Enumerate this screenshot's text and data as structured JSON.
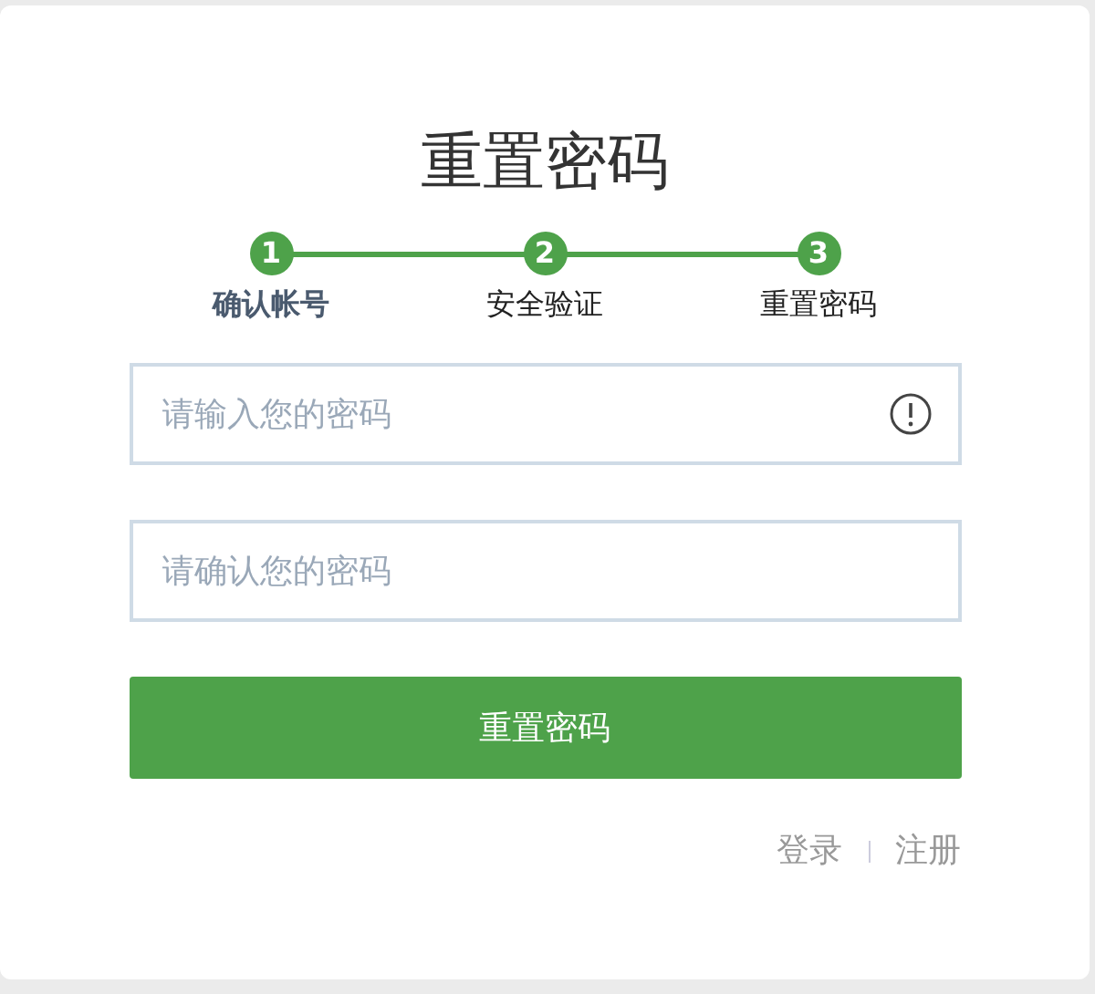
{
  "title": "重置密码",
  "steps": [
    {
      "number": "1",
      "label": "确认帐号",
      "selected": true
    },
    {
      "number": "2",
      "label": "安全验证",
      "selected": false
    },
    {
      "number": "3",
      "label": "重置密码",
      "selected": false
    }
  ],
  "fields": [
    {
      "placeholder": "请输入您的密码",
      "warning": true
    },
    {
      "placeholder": "请确认您的密码",
      "warning": false
    }
  ],
  "submit": "重置密码",
  "links": [
    "登录",
    "注册"
  ]
}
